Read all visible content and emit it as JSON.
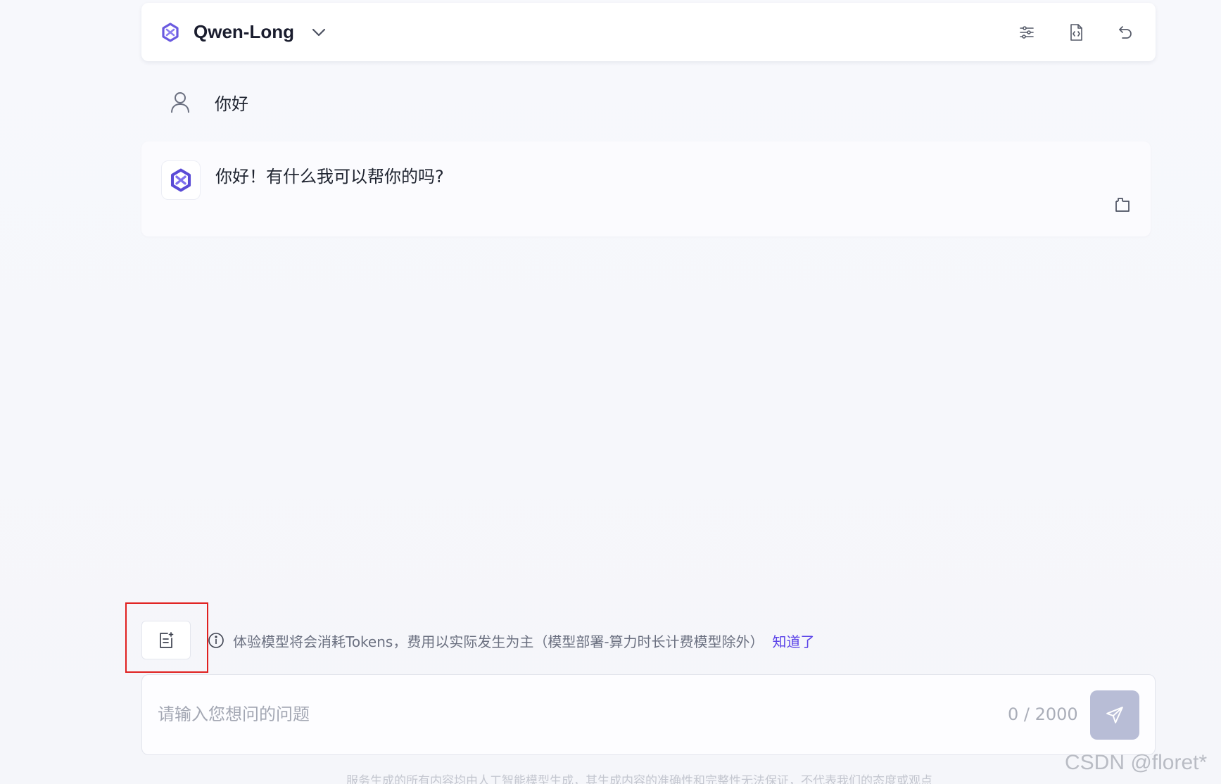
{
  "header": {
    "model_name": "Qwen-Long",
    "logo_icon": "qwen-logo-icon",
    "actions": [
      {
        "name": "settings-sliders-icon"
      },
      {
        "name": "code-file-icon"
      },
      {
        "name": "undo-icon"
      }
    ]
  },
  "conversation": {
    "user_message": "你好",
    "assistant_message": "你好！有什么我可以帮你的吗?"
  },
  "notice": {
    "text": "体验模型将会消耗Tokens，费用以实际发生为主（模型部署-算力时长计费模型除外）",
    "link": "知道了"
  },
  "input": {
    "placeholder": "请输入您想问的问题",
    "counter": "0 / 2000"
  },
  "footer": {
    "disclaimer": "服务生成的所有内容均由人工智能模型生成，其生成内容的准确性和完整性无法保证，不代表我们的态度或观点"
  },
  "watermark": "CSDN @floret*",
  "colors": {
    "accent": "#5b43e8",
    "send_button": "#b8bdd6",
    "highlight": "#e0201f"
  }
}
